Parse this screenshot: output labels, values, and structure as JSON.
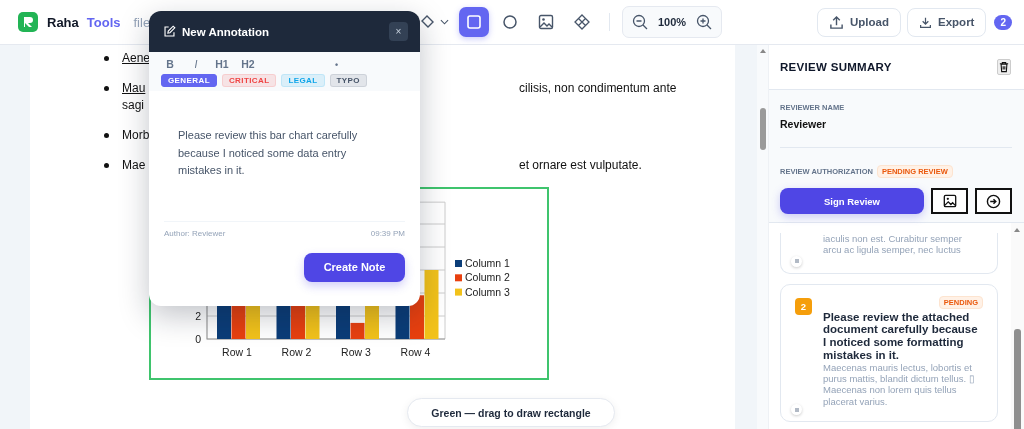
{
  "header": {
    "brand": "Raha",
    "brand_accent": "Tools",
    "file_label": "file"
  },
  "tools": [
    {
      "kind": "fill",
      "menu": true,
      "selected": false
    },
    {
      "kind": "rectangle",
      "menu": false,
      "selected": true
    },
    {
      "kind": "circle",
      "menu": false,
      "selected": false
    },
    {
      "kind": "image",
      "menu": false,
      "selected": false
    },
    {
      "kind": "diamond",
      "menu": false,
      "selected": false
    }
  ],
  "zoom": {
    "reading": "100%"
  },
  "actions": [
    {
      "kind": "upload",
      "label": "Upload"
    },
    {
      "kind": "export",
      "label": "Export"
    }
  ],
  "count_badge": "2",
  "document": {
    "bullets": [
      {
        "start": "Aene",
        "underline": true
      },
      {
        "start": "Mau",
        "underline": true,
        "end": "cilisis, non condimentum ante",
        "continuation": "sagi"
      },
      {
        "start": "Morb",
        "underline": false
      },
      {
        "start": "Mae",
        "underline": false,
        "end": "et ornare est vulputate."
      }
    ],
    "chart": {
      "y_labels": [
        "2",
        "0"
      ],
      "categories": [
        "Row 1",
        "Row 2",
        "Row 3",
        "Row 4"
      ],
      "legend": [
        {
          "name": "Column 1",
          "color": "#0b3d78"
        },
        {
          "name": "Column 2",
          "color": "#e8400f"
        },
        {
          "name": "Column 3",
          "color": "#f2c21a"
        }
      ]
    }
  },
  "annotation": {
    "title": "New Annotation",
    "close": "×",
    "format_buttons": [
      {
        "label": "B",
        "kind": "bold"
      },
      {
        "label": "I",
        "kind": "italic"
      },
      {
        "label": "H1",
        "kind": "heading"
      },
      {
        "label": "H2",
        "kind": "heading"
      },
      {
        "label": "•",
        "kind": "list"
      }
    ],
    "tags": [
      {
        "label": "GENERAL",
        "color": "#6366f1",
        "selected": true
      },
      {
        "label": "CRITICAL",
        "color": "#ef4444",
        "selected": false
      },
      {
        "label": "LEGAL",
        "color": "#0ea5e9",
        "selected": false
      },
      {
        "label": "TYPO",
        "color": "#475569",
        "selected": false
      }
    ],
    "text": "Please review this bar chart carefully because I noticed some data entry mistakes in it.",
    "author": "Author: Reviewer",
    "time": "09:39 PM",
    "submit": "Create Note"
  },
  "hint": "Green — drag to draw rectangle",
  "review": {
    "title": "REVIEW SUMMARY",
    "reviewer_label": "REVIEWER NAME",
    "reviewer": "Reviewer",
    "auth_label": "REVIEW AUTHORIZATION",
    "auth_status": "PENDING REVIEW",
    "sign": "Sign Review",
    "notes": [
      {
        "body": "iaculis non est. Curabitur semper arcu ac ligula semper, nec luctus"
      },
      {
        "number": "2",
        "status": "PENDING",
        "title": "Please review the attached document carefully because I noticed some formatting mistakes in it.",
        "body": "Maecenas mauris lectus, lobortis et purus mattis, blandit dictum tellus. ▯ Maecenas non lorem quis tellus placerat varius."
      }
    ]
  }
}
